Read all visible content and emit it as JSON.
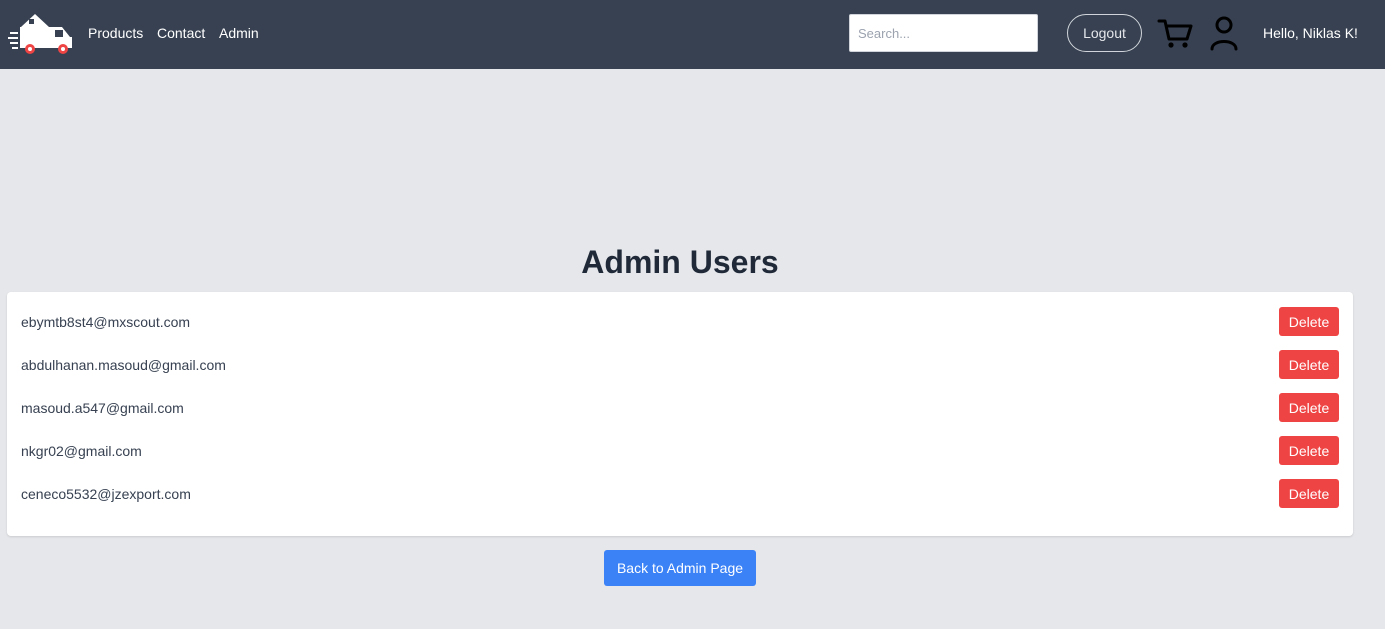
{
  "nav": {
    "logo_icon": "delivery-truck-logo",
    "links": [
      "Products",
      "Contact",
      "Admin"
    ],
    "search_placeholder": "Search...",
    "search_value": "",
    "logout_label": "Logout",
    "cart_icon": "shopping-cart-icon",
    "user_icon": "user-profile-icon",
    "greeting": "Hello, Niklas K!"
  },
  "main": {
    "title": "Admin Users",
    "users": [
      {
        "email": "ebymtb8st4@mxscout.com",
        "action": "Delete"
      },
      {
        "email": "abdulhanan.masoud@gmail.com",
        "action": "Delete"
      },
      {
        "email": "masoud.a547@gmail.com",
        "action": "Delete"
      },
      {
        "email": "nkgr02@gmail.com",
        "action": "Delete"
      },
      {
        "email": "ceneco5532@jzexport.com",
        "action": "Delete"
      }
    ],
    "back_label": "Back to Admin Page"
  },
  "colors": {
    "navbar_bg": "#374151",
    "page_bg": "#e5e7eb",
    "delete_red": "#ef4444",
    "primary_blue": "#3b82f6",
    "title_text": "#1f2937"
  }
}
